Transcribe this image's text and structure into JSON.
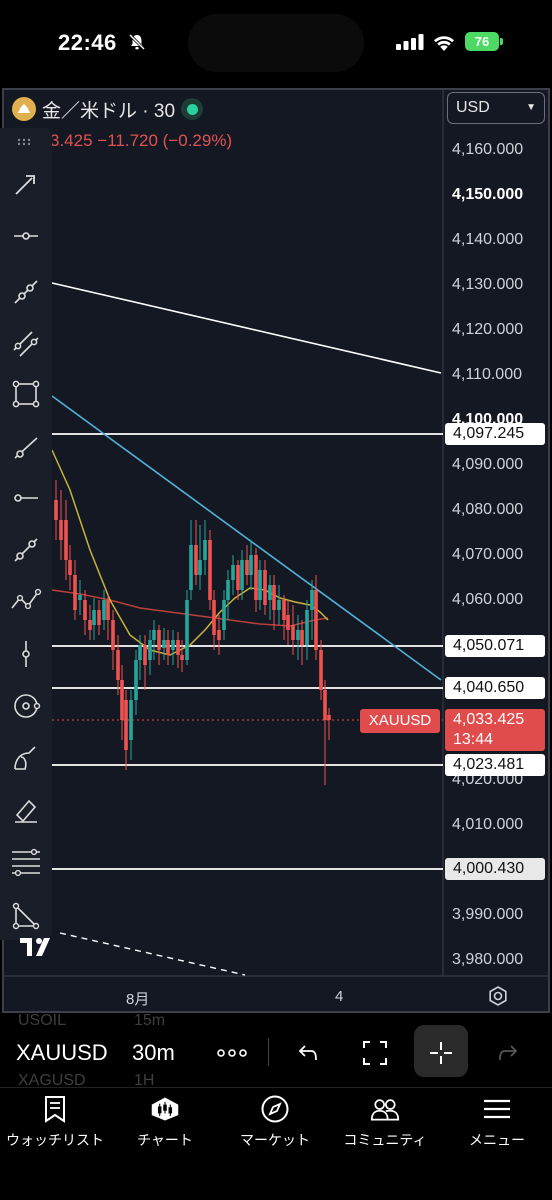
{
  "status_bar": {
    "time": "22:46",
    "battery": "76"
  },
  "chart": {
    "symbol_title": "金／米ドル · 30",
    "price_change": "3.425  −11.720 (−0.29%)",
    "currency": "USD",
    "price_axis": [
      "4,160.000",
      "4,150.000",
      "4,140.000",
      "4,130.000",
      "4,120.000",
      "4,110.000",
      "4,100.000",
      "4,090.000",
      "4,080.000",
      "4,070.000",
      "4,060.000",
      "4,020.000",
      "4,010.000",
      "3,990.000",
      "3,980.000"
    ],
    "level_tags": {
      "l1": "4,097.245",
      "l2": "4,050.071",
      "l3": "4,040.650",
      "l4": "4,023.481",
      "l5": "4,000.430"
    },
    "current_price": "4,033.425",
    "countdown": "13:44",
    "symbol_label": "XAUUSD",
    "time_axis": [
      "8月",
      "4"
    ],
    "colors": {
      "background": "#141823",
      "bull": "#26a69a",
      "bear": "#ef5350",
      "trend": "#4fb3d9",
      "ma_fast": "#c9b23a",
      "ma_slow": "#b8403a"
    }
  },
  "toolbar": {
    "symbol": "XAUUSD",
    "interval": "30m",
    "ghost_rows": [
      "USOIL",
      "15m",
      "XAGUSD",
      "1H"
    ]
  },
  "tabs": [
    {
      "label": "ウォッチリスト",
      "icon": "bookmark-icon"
    },
    {
      "label": "チャート",
      "icon": "chart-icon"
    },
    {
      "label": "マーケット",
      "icon": "compass-icon"
    },
    {
      "label": "コミュニティ",
      "icon": "people-icon"
    },
    {
      "label": "メニュー",
      "icon": "menu-icon"
    }
  ]
}
